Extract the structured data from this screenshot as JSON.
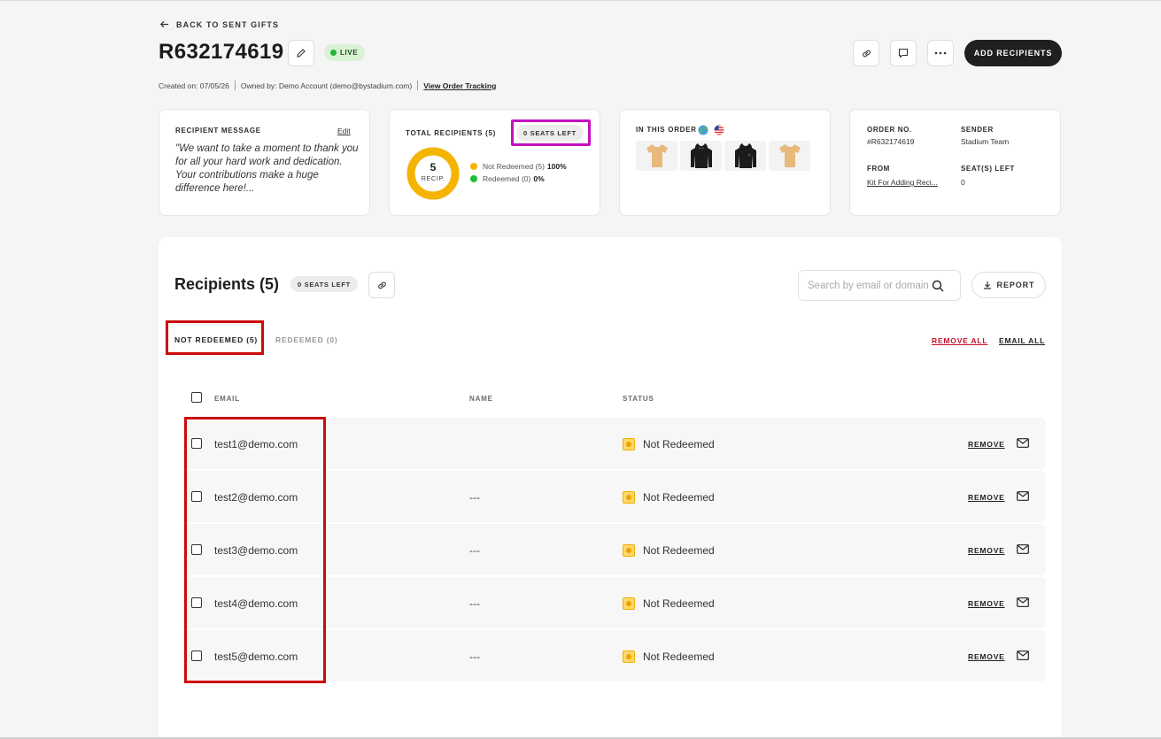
{
  "header": {
    "back_label": "BACK TO SENT GIFTS",
    "order_id": "R632174619",
    "status_badge": "LIVE",
    "created_on": "Created on: 07/05/26",
    "owned_by": "Owned by: Demo Account (demo@bystadium.com)",
    "tracking_link": "View Order Tracking",
    "add_recipients_label": "ADD RECIPIENTS"
  },
  "cards": {
    "message": {
      "label": "RECIPIENT MESSAGE",
      "edit_label": "Edit",
      "text": "\"We want to take a moment to thank you for all your hard work and dedication. Your contributions make a huge difference here!..."
    },
    "recipients": {
      "label": "TOTAL RECIPIENTS (5)",
      "seats_left": "0 SEATS LEFT",
      "donut_number": "5",
      "donut_caption": "RECIP.",
      "not_redeemed_label": "Not Redeemed (5)",
      "not_redeemed_pct": "100%",
      "redeemed_label": "Redeemed (0)",
      "redeemed_pct": "0%",
      "not_redeemed_fraction": 1.0
    },
    "order": {
      "label": "IN THIS ORDER",
      "items": [
        "tan-tshirt",
        "black-hoodie",
        "black-hoodie",
        "tan-tshirt"
      ]
    },
    "info": {
      "order_no_label": "ORDER NO.",
      "order_no": "#R632174619",
      "sender_label": "SENDER",
      "sender": "Stadium Team",
      "from_label": "FROM",
      "from": "Kit For Adding Reci...",
      "seats_label": "SEAT(S) LEFT",
      "seats": "0"
    }
  },
  "recipients": {
    "title": "Recipients (5)",
    "seats_left": "0 SEATS LEFT",
    "search_placeholder": "Search by email or domain",
    "report_label": "REPORT",
    "tabs": [
      "NOT REDEEMED (5)",
      "REDEEMED (0)"
    ],
    "remove_all": "REMOVE ALL",
    "email_all": "EMAIL ALL",
    "columns": {
      "email": "EMAIL",
      "name": "NAME",
      "status": "STATUS"
    },
    "rows": [
      {
        "email": "test1@demo.com",
        "name": "",
        "status": "Not Redeemed",
        "remove": "REMOVE"
      },
      {
        "email": "test2@demo.com",
        "name": "---",
        "status": "Not Redeemed",
        "remove": "REMOVE"
      },
      {
        "email": "test3@demo.com",
        "name": "---",
        "status": "Not Redeemed",
        "remove": "REMOVE"
      },
      {
        "email": "test4@demo.com",
        "name": "---",
        "status": "Not Redeemed",
        "remove": "REMOVE"
      },
      {
        "email": "test5@demo.com",
        "name": "---",
        "status": "Not Redeemed",
        "remove": "REMOVE"
      }
    ]
  },
  "colors": {
    "accent_dark": "#1f1f1f",
    "live_green": "#25b43a",
    "not_redeemed_yellow": "#f5b400",
    "redeemed_green": "#1fbf3a",
    "highlight_red": "#cc0b0b",
    "highlight_magenta": "#c40fc0",
    "remove_all_red": "#c8102e"
  }
}
